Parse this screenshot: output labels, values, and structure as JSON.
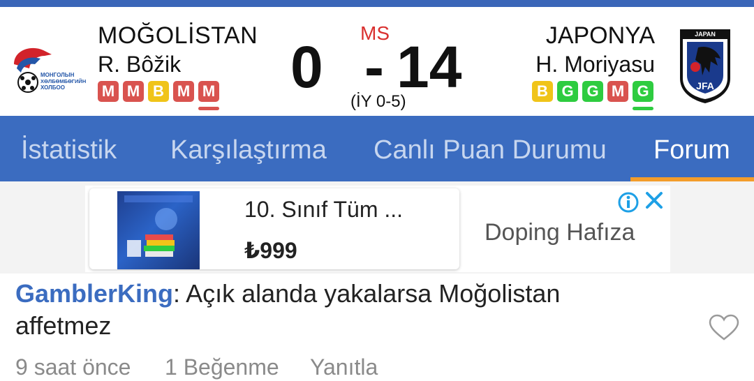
{
  "match": {
    "home": {
      "name": "MOĞOLİSTAN",
      "coach": "R. Bôžik",
      "score": "0",
      "form": [
        "M",
        "M",
        "B",
        "M",
        "M"
      ],
      "logo_text": [
        "МОНГОЛЫН",
        "ХӨЛБӨМБӨГИЙН",
        "ХОЛБОО"
      ]
    },
    "away": {
      "name": "JAPONYA",
      "coach": "H. Moriyasu",
      "score": "14",
      "form": [
        "B",
        "G",
        "G",
        "M",
        "G"
      ],
      "logo_text": [
        "JAPAN",
        "JFA"
      ]
    },
    "status": "MS",
    "dash": "-",
    "halftime": "(İY 0-5)"
  },
  "tabs": [
    {
      "label": "İstatistik"
    },
    {
      "label": "Karşılaştırma"
    },
    {
      "label": "Canlı Puan Durumu"
    },
    {
      "label": "Forum",
      "active": true
    }
  ],
  "ad": {
    "title": "10. Sınıf Tüm ...",
    "price": "₺999",
    "brand": "Doping Hafıza",
    "info_icon": "info-icon",
    "close_icon": "close-icon"
  },
  "comment": {
    "user": "GamblerKing",
    "separator": ":",
    "text": " Açık alanda yakalarsa Moğolistan affetmez",
    "time": "9 saat önce",
    "likes": "1 Beğenme",
    "reply": "Yanıtla",
    "like_icon": "heart-icon"
  },
  "colors": {
    "accent": "#3b6cc0",
    "tab_indicator": "#f39c2a",
    "loss": "#d9534f",
    "draw": "#f0c419",
    "win": "#2ecc40",
    "status": "#d9302f"
  }
}
